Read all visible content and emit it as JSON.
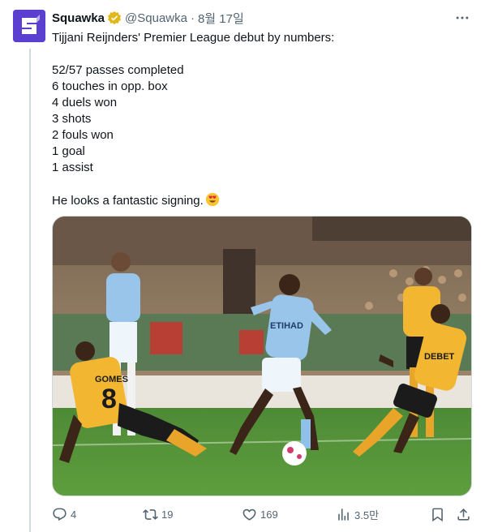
{
  "tweet": {
    "author_name": "Squawka",
    "handle": "@Squawka",
    "separator": "·",
    "time": "8월 17일",
    "text_lines": [
      "Tijjani Reijnders' Premier League debut by numbers:",
      "",
      "52/57 passes completed",
      "6 touches in opp. box",
      "4 duels won",
      "3 shots",
      "2 fouls won",
      "1 goal",
      "1 assist",
      "",
      "He looks a fantastic signing."
    ],
    "emoji": "heart-eyes",
    "verified_color": "#e2b719",
    "avatar_color": "#5b3fd1"
  },
  "media": {
    "jersey_sponsor": "ETIHAD",
    "jersey_sponsor_2": "DEBET",
    "player_number": "8",
    "player_name": "GOMES"
  },
  "actions": {
    "replies": "4",
    "retweets": "19",
    "likes": "169",
    "views": "3.5만"
  }
}
